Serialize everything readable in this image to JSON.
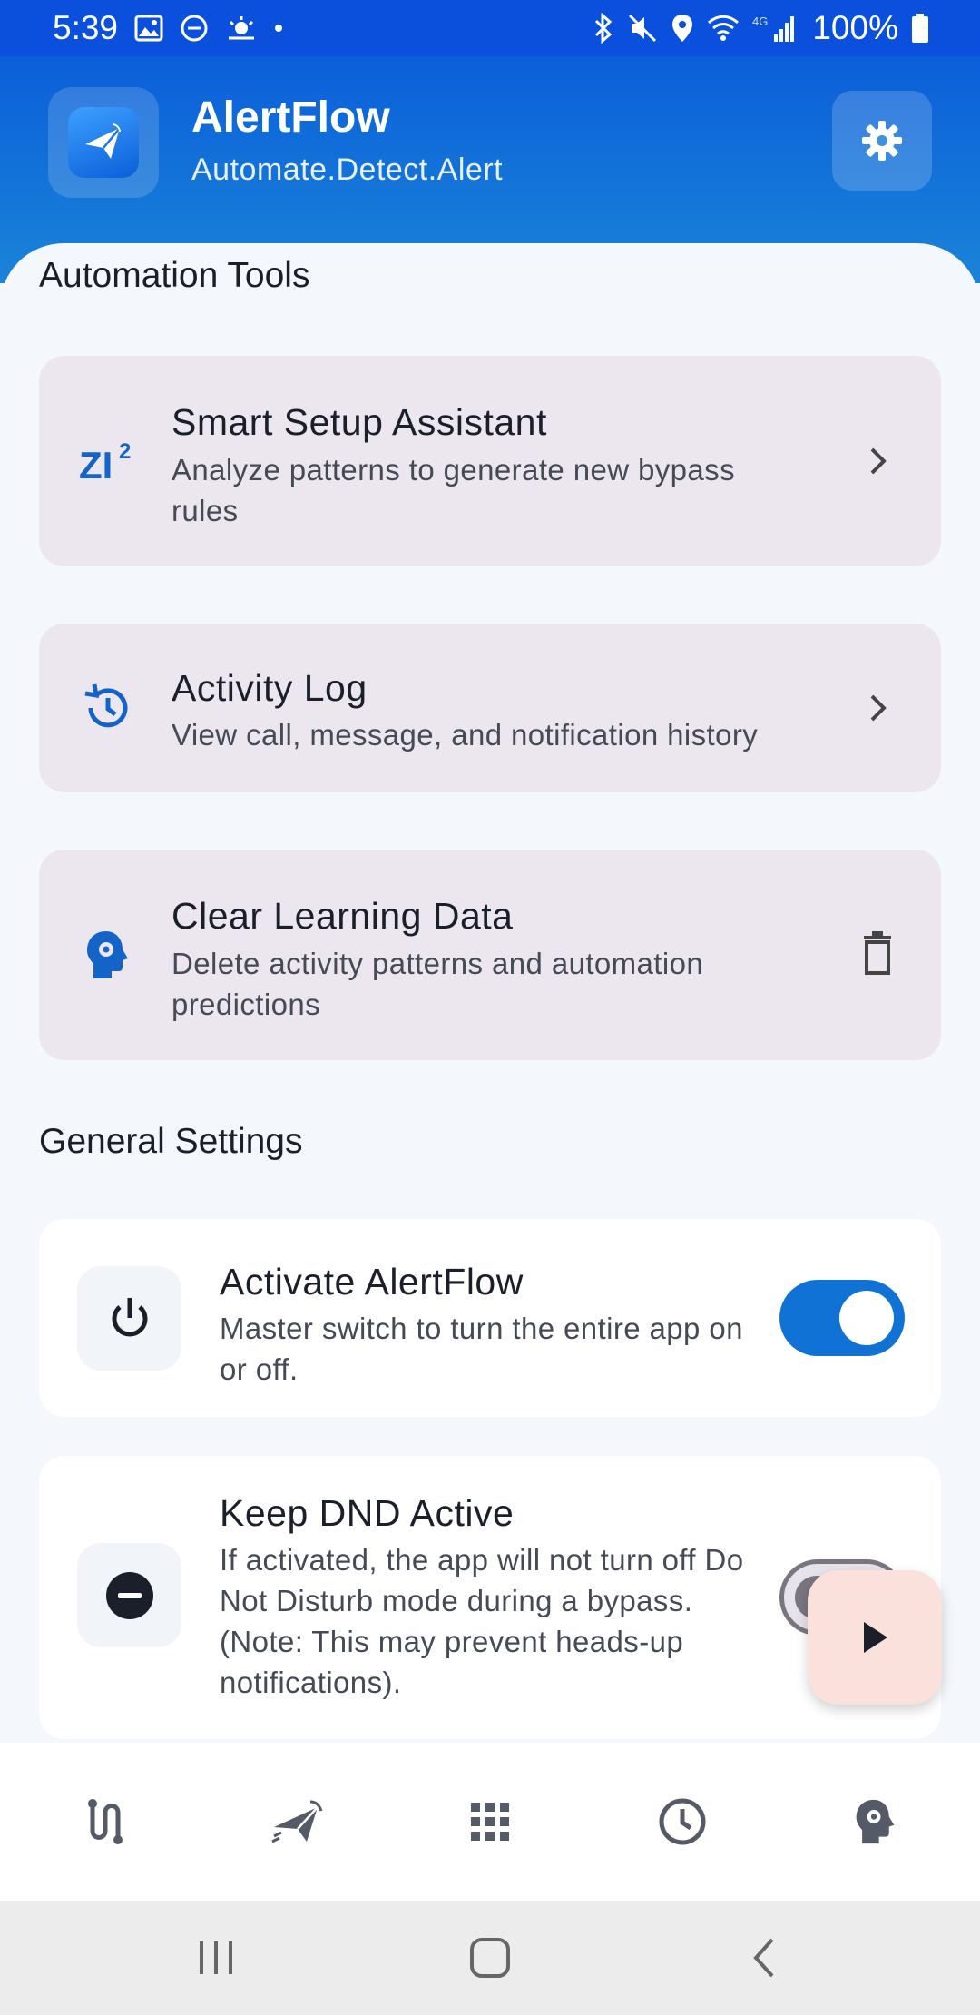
{
  "status_bar": {
    "time": "5:39",
    "battery": "100%",
    "network_label": "4G"
  },
  "header": {
    "app_name": "AlertFlow",
    "tagline": "Automate.Detect.Alert"
  },
  "automation_tools": {
    "section_title": "Automation Tools",
    "items": [
      {
        "title": "Smart Setup Assistant",
        "desc": "Analyze patterns to generate new bypass rules",
        "icon": "zi2-icon",
        "trailing": "chevron-right-icon"
      },
      {
        "title": "Activity Log",
        "desc": "View call, message, and notification history",
        "icon": "history-icon",
        "trailing": "chevron-right-icon"
      },
      {
        "title": "Clear Learning Data",
        "desc": "Delete activity patterns and automation predictions",
        "icon": "head-gear-icon",
        "trailing": "trash-icon"
      }
    ]
  },
  "general_settings": {
    "section_title": "General Settings",
    "items": [
      {
        "title": "Activate AlertFlow",
        "desc": "Master switch to turn the entire app on or off.",
        "icon": "power-icon",
        "toggle": "on"
      },
      {
        "title": "Keep DND Active",
        "desc": "If activated, the app will not turn off Do Not Disturb mode during a bypass. (Note: This may prevent heads-up notifications).",
        "icon": "dnd-icon",
        "toggle": "off"
      }
    ]
  },
  "colors": {
    "accent": "#1172d6",
    "header_top": "#0b5fd9",
    "card_bg": "#ece6ef",
    "fab_bg": "#fbe1dc"
  },
  "bottom_nav": [
    "route-icon",
    "send-icon",
    "apps-grid-icon",
    "clock-icon",
    "head-gear-icon"
  ]
}
